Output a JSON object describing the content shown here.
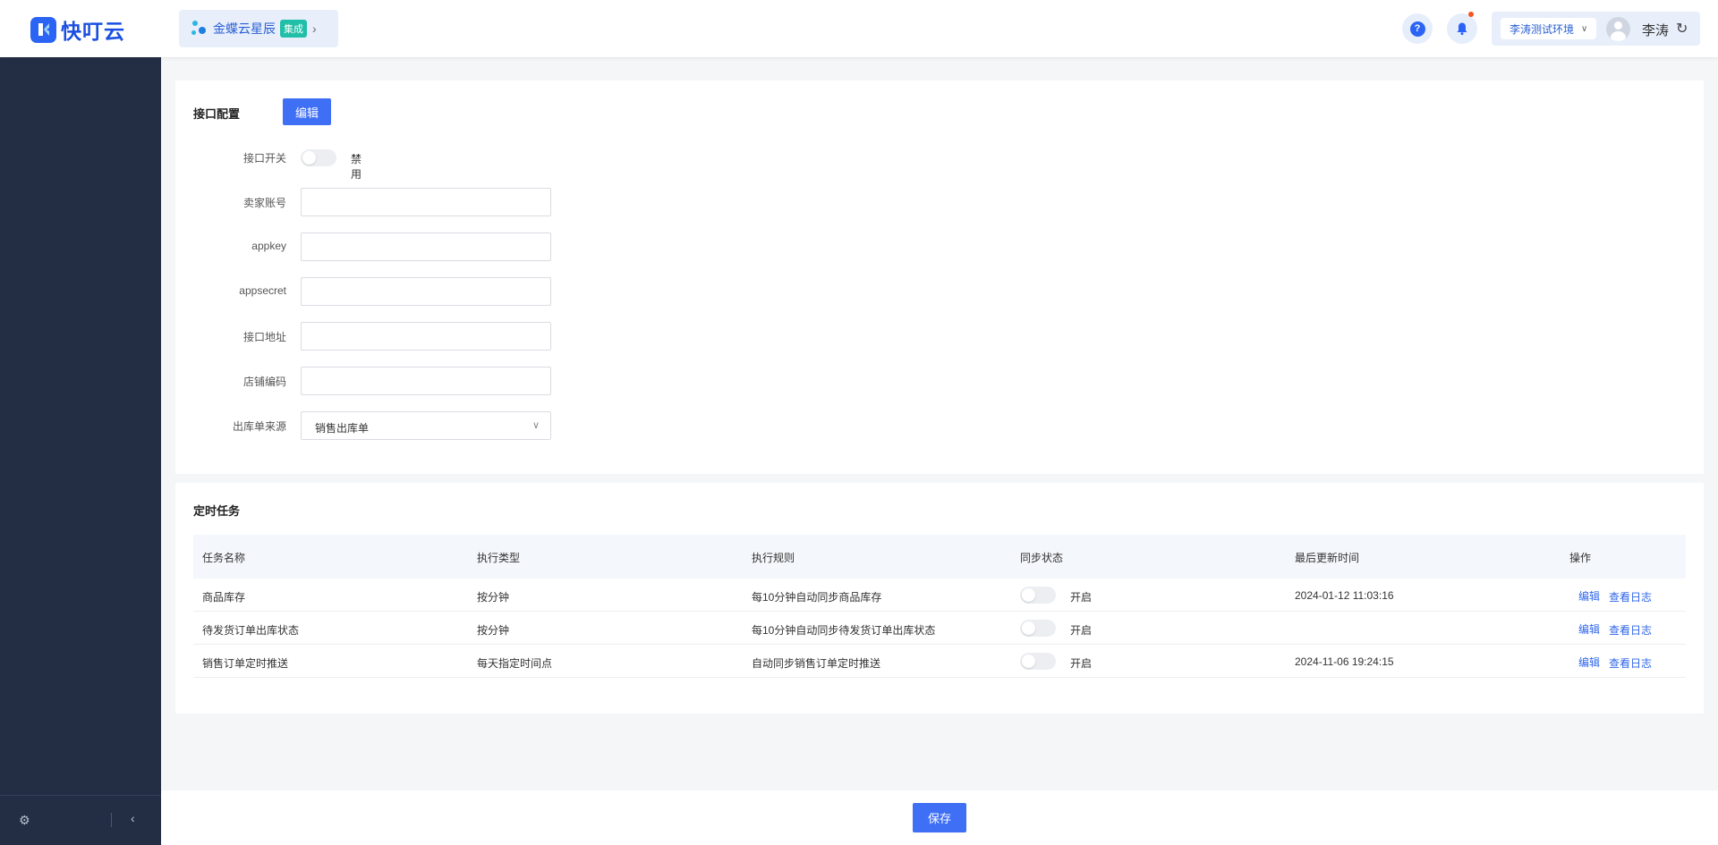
{
  "header": {
    "logo_text": "快叮云",
    "app_name": "金蝶云星辰",
    "app_tag": "集成",
    "help_label": "?",
    "environment": "李涛测试环境",
    "username": "李涛"
  },
  "config": {
    "title": "接口配置",
    "edit_label": "编辑",
    "switch": {
      "label": "接口开关",
      "status": "禁用",
      "on": false
    },
    "fields": [
      {
        "label": "卖家账号",
        "value": ""
      },
      {
        "label": "appkey",
        "value": ""
      },
      {
        "label": "appsecret",
        "value": ""
      },
      {
        "label": "接口地址",
        "value": ""
      },
      {
        "label": "店铺编码",
        "value": ""
      }
    ],
    "source": {
      "label": "出库单来源",
      "value": "销售出库单"
    }
  },
  "tasks": {
    "title": "定时任务",
    "columns": [
      "任务名称",
      "执行类型",
      "执行规则",
      "同步状态",
      "最后更新时间",
      "操作"
    ],
    "rows": [
      {
        "name": "商品库存",
        "type": "按分钟",
        "rule": "每10分钟自动同步商品库存",
        "status": "开启",
        "updated": "2024-01-12 11:03:16",
        "edit": "编辑",
        "log": "查看日志"
      },
      {
        "name": "待发货订单出库状态",
        "type": "按分钟",
        "rule": "每10分钟自动同步待发货订单出库状态",
        "status": "开启",
        "updated": "",
        "edit": "编辑",
        "log": "查看日志"
      },
      {
        "name": "销售订单定时推送",
        "type": "每天指定时间点",
        "rule": "自动同步销售订单定时推送",
        "status": "开启",
        "updated": "2024-11-06 19:24:15",
        "edit": "编辑",
        "log": "查看日志"
      }
    ]
  },
  "footer": {
    "save_label": "保存"
  },
  "colors": {
    "primary": "#3f6ff5",
    "sidebar": "#232d44",
    "link": "#2f66e9",
    "tag": "#1fbfa8"
  }
}
